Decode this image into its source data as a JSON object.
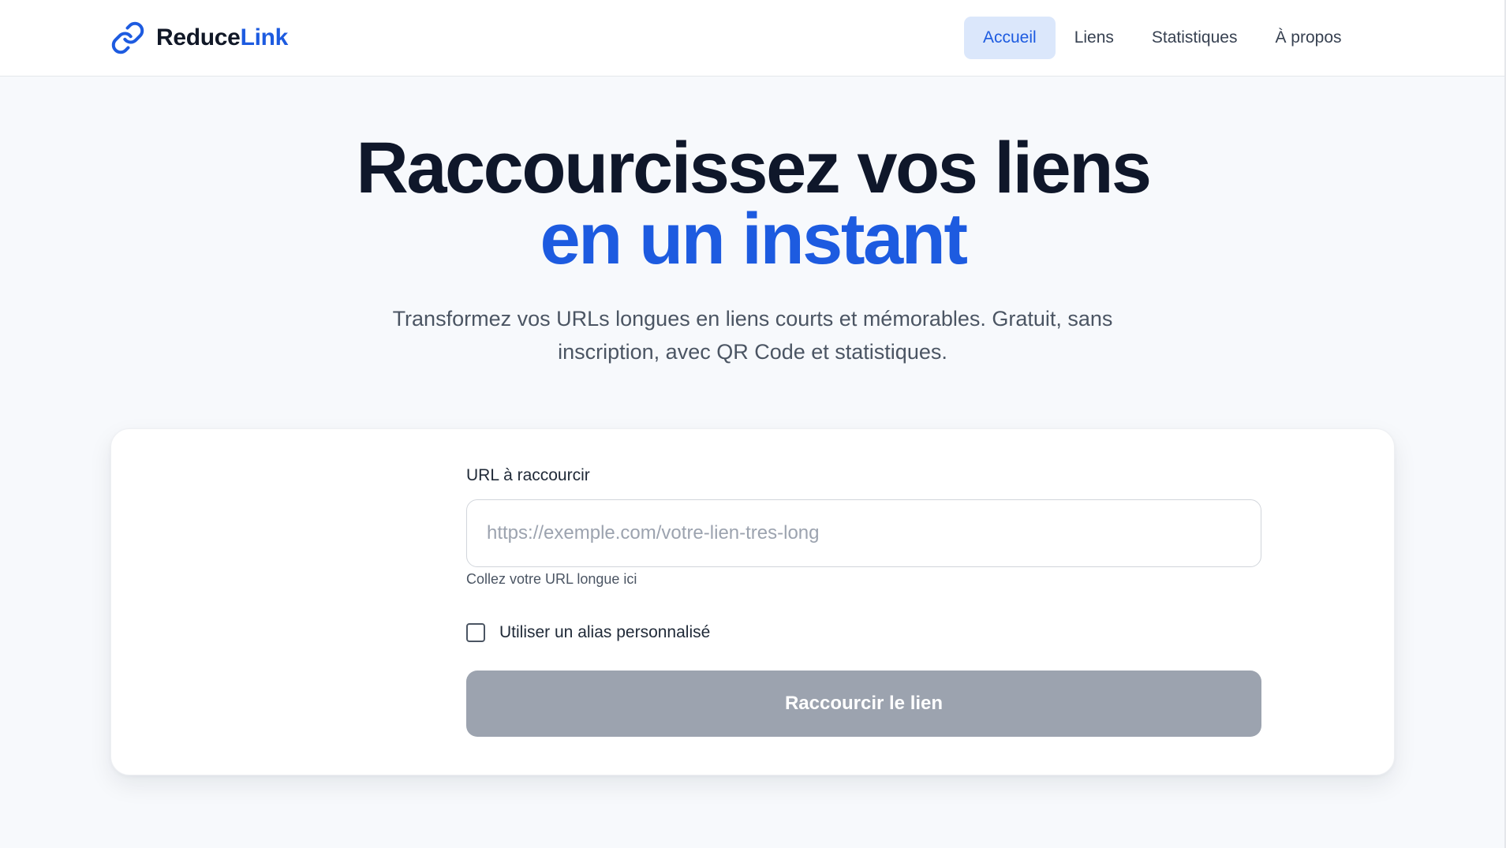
{
  "brand": {
    "name_part1": "Reduce",
    "name_part2": "Link",
    "icon": "link-icon",
    "accent_color": "#1d5be0"
  },
  "nav": {
    "items": [
      {
        "label": "Accueil",
        "active": true
      },
      {
        "label": "Liens",
        "active": false
      },
      {
        "label": "Statistiques",
        "active": false
      },
      {
        "label": "À propos",
        "active": false
      }
    ]
  },
  "hero": {
    "title_line1": "Raccourcissez vos liens",
    "title_line2": "en un instant",
    "subtitle": "Transformez vos URLs longues en liens courts et mémorables. Gratuit, sans inscription, avec QR Code et statistiques."
  },
  "form": {
    "url_label": "URL à raccourcir",
    "url_value": "",
    "url_placeholder": "https://exemple.com/votre-lien-tres-long",
    "url_helper": "Collez votre URL longue ici",
    "alias_label": "Utiliser un alias personnalisé",
    "alias_checked": false,
    "submit_label": "Raccourcir le lien",
    "submit_color": "#9ca3af"
  }
}
